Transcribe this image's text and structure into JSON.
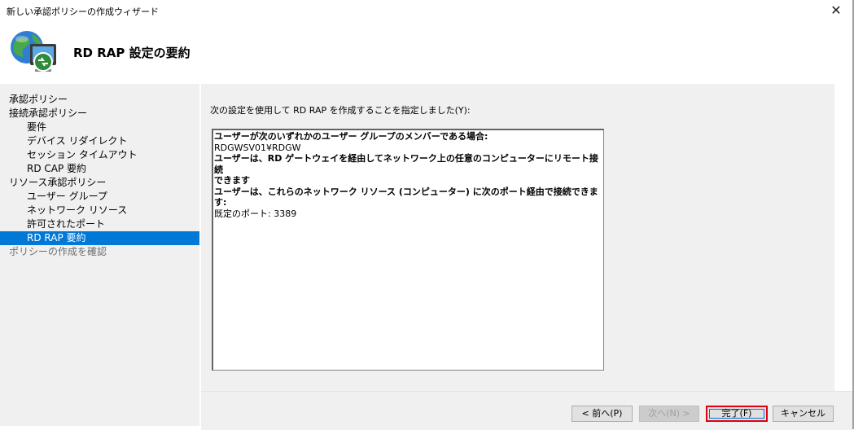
{
  "window": {
    "title": "新しい承認ポリシーの作成ウィザード",
    "close_glyph": "✕"
  },
  "header": {
    "title": "RD RAP 設定の要約",
    "icon": "network-policy-icon"
  },
  "nav": {
    "items": [
      {
        "label": "承認ポリシー",
        "level": 0,
        "state": "normal"
      },
      {
        "label": "接続承認ポリシー",
        "level": 0,
        "state": "normal"
      },
      {
        "label": "要件",
        "level": 1,
        "state": "normal"
      },
      {
        "label": "デバイス リダイレクト",
        "level": 1,
        "state": "normal"
      },
      {
        "label": "セッション タイムアウト",
        "level": 1,
        "state": "normal"
      },
      {
        "label": "RD CAP 要約",
        "level": 1,
        "state": "normal"
      },
      {
        "label": "リソース承認ポリシー",
        "level": 0,
        "state": "normal"
      },
      {
        "label": "ユーザー グループ",
        "level": 1,
        "state": "normal"
      },
      {
        "label": "ネットワーク リソース",
        "level": 1,
        "state": "normal"
      },
      {
        "label": "許可されたポート",
        "level": 1,
        "state": "normal"
      },
      {
        "label": "RD RAP 要約",
        "level": 1,
        "state": "selected"
      },
      {
        "label": "ポリシーの作成を確認",
        "level": 0,
        "state": "disabled"
      }
    ]
  },
  "content": {
    "intro": "次の設定を使用して RD RAP を作成することを指定しました(Y):",
    "summary_lines": [
      {
        "text": "ユーザーが次のいずれかのユーザー グループのメンバーである場合:",
        "bold": true
      },
      {
        "text": "RDGWSV01¥RDGW",
        "bold": false
      },
      {
        "text": "ユーザーは、RD ゲートウェイを経由してネットワーク上の任意のコンピューターにリモート接続",
        "bold": true
      },
      {
        "text": "できます",
        "bold": true
      },
      {
        "text": "ユーザーは、これらのネットワーク リソース (コンピューター) に次のポート経由で接続できま",
        "bold": true
      },
      {
        "text": "す:",
        "bold": true
      },
      {
        "text": "既定のポート: 3389",
        "bold": false
      }
    ]
  },
  "footer": {
    "back_label": "< 前へ(P)",
    "next_label": "次へ(N) >",
    "finish_label": "完了(F)",
    "cancel_label": "キャンセル"
  },
  "colors": {
    "selection": "#0078d7",
    "highlight_border": "#e00010",
    "panel_bg": "#f0f0f0"
  }
}
